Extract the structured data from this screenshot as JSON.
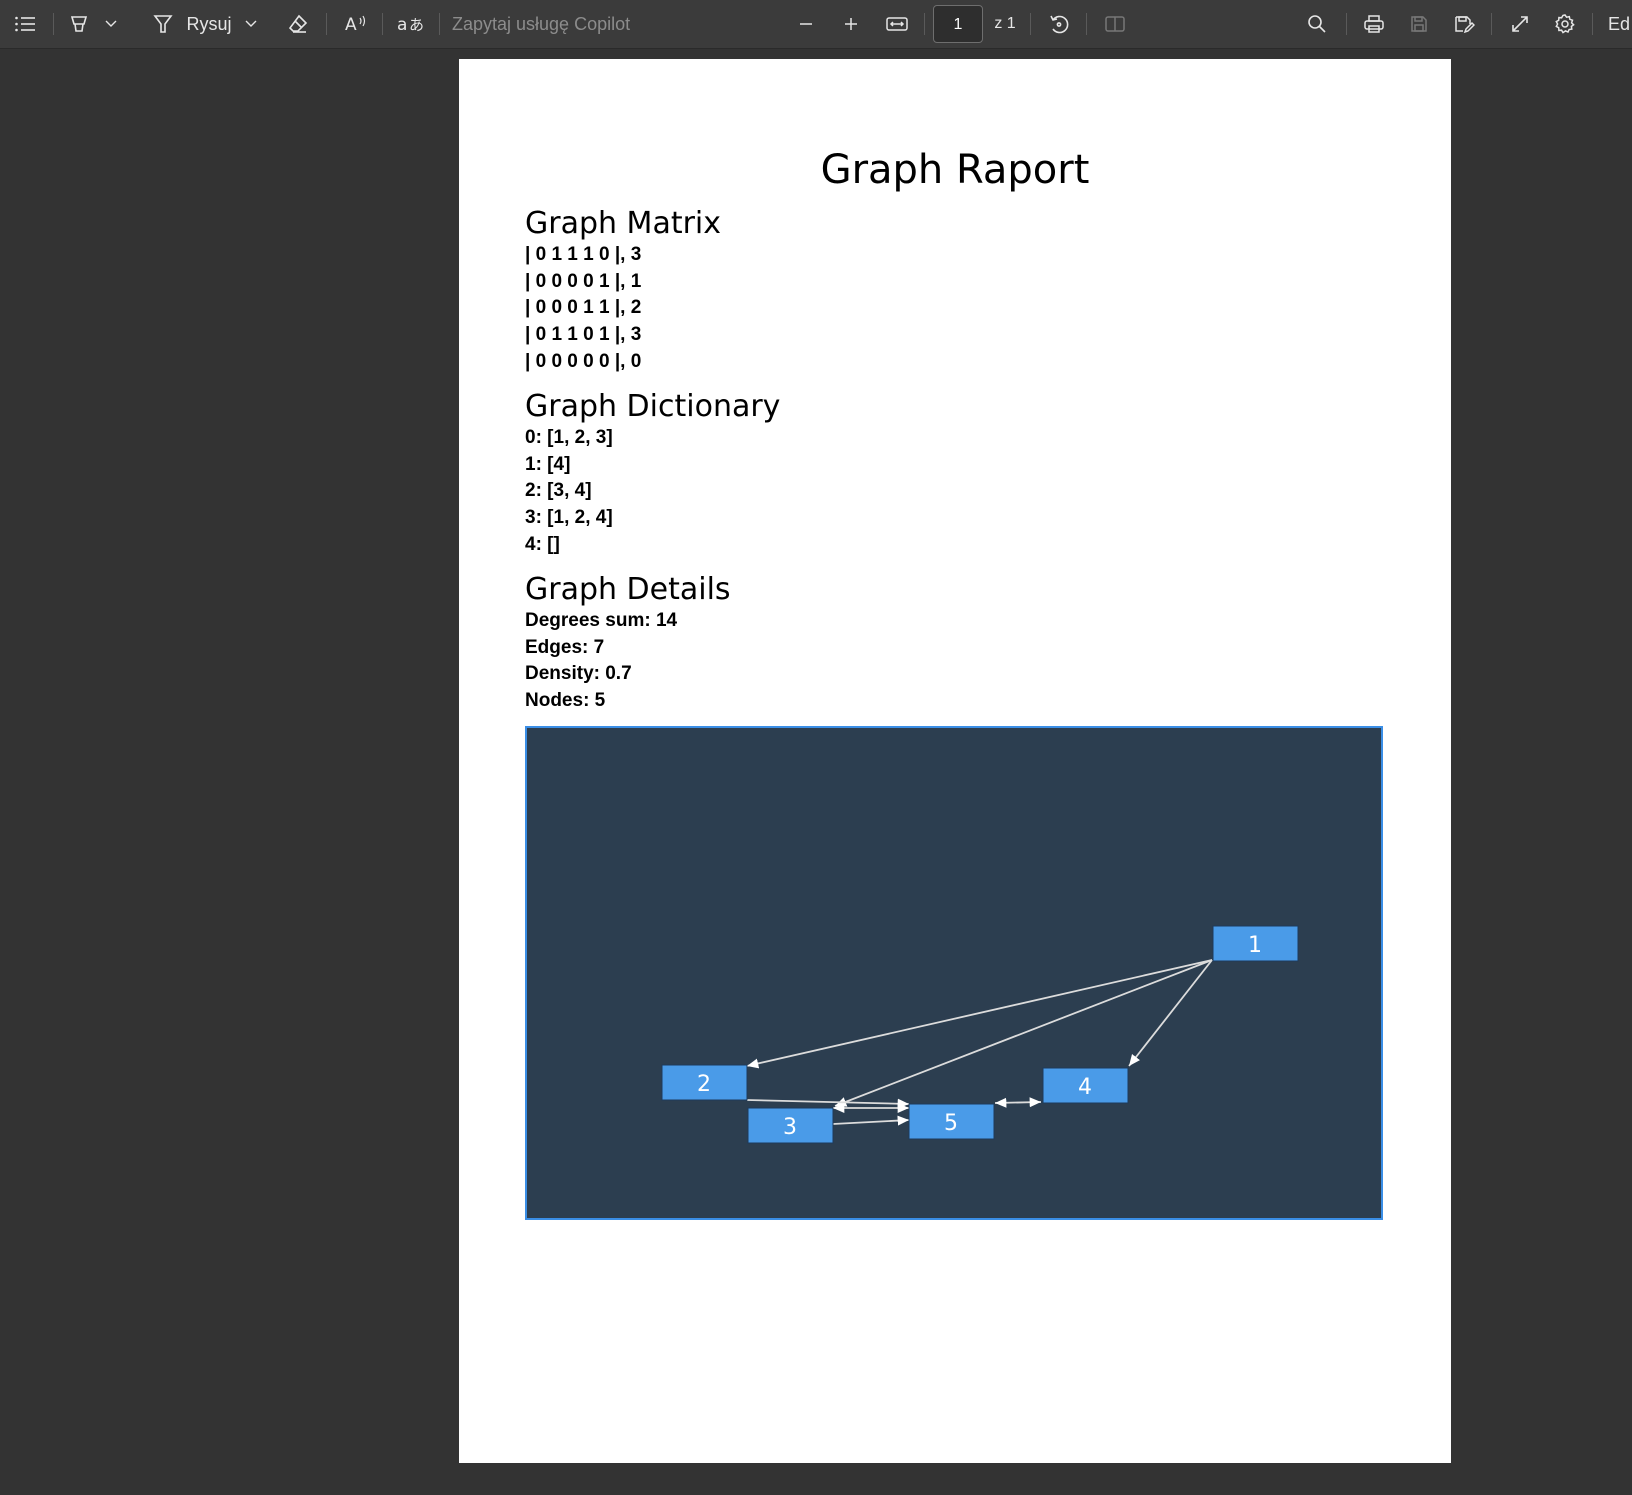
{
  "toolbar": {
    "draw_label": "Rysuj",
    "copilot_placeholder": "Zapytaj usługę Copilot",
    "page_number": "1",
    "page_of": "z 1",
    "edge_label": "Ed"
  },
  "document": {
    "title": "Graph Raport",
    "matrix": {
      "heading": "Graph Matrix",
      "rows": [
        "| 0 1 1 1 0 |, 3",
        "| 0 0 0 0 1 |, 1",
        "| 0 0 0 1 1 |, 2",
        "| 0 1 1 0 1 |, 3",
        "| 0 0 0 0 0 |, 0"
      ]
    },
    "dictionary": {
      "heading": "Graph Dictionary",
      "rows": [
        "0: [1, 2, 3]",
        "1: [4]",
        "2: [3, 4]",
        "3: [1, 2, 4]",
        "4: []"
      ]
    },
    "details": {
      "heading": "Graph Details",
      "rows": [
        "Degrees sum: 14",
        "Edges: 7",
        "Density: 0.7",
        "Nodes: 5"
      ]
    },
    "graph": {
      "node_color": "#4a9be8",
      "background_color": "#2c3e50",
      "nodes": [
        "1",
        "2",
        "3",
        "4",
        "5"
      ]
    }
  }
}
